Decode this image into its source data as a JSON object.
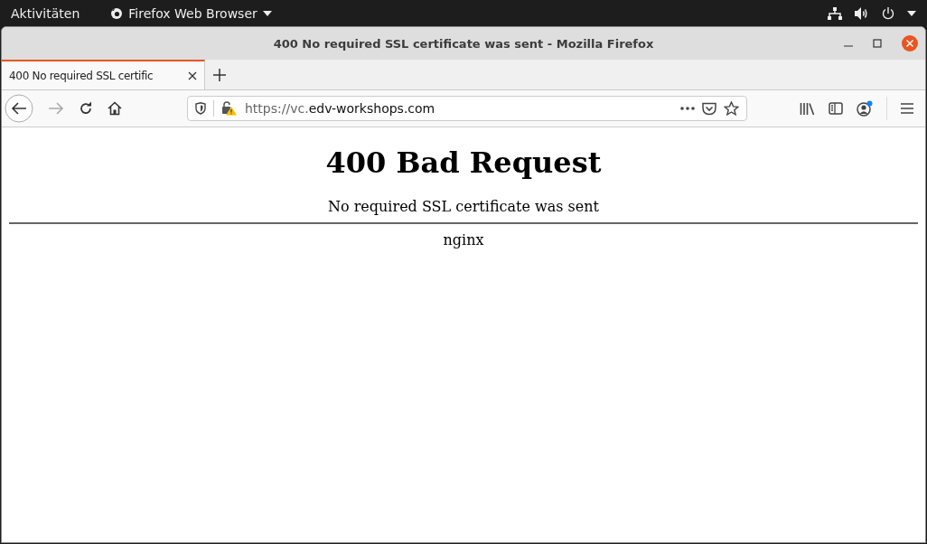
{
  "top_bar": {
    "activities": "Aktivitäten",
    "app_menu": "Firefox Web Browser"
  },
  "window": {
    "title": "400 No required SSL certificate was sent - Mozilla Firefox"
  },
  "tabs": [
    {
      "label": "400 No required SSL certific",
      "selected": true
    }
  ],
  "address_bar": {
    "url_prefix": "https://vc.",
    "url_domain": "edv-workshops.com"
  },
  "toolbar": {
    "forward_disabled": true,
    "account_notification": true
  },
  "page": {
    "heading": "400 Bad Request",
    "message": "No required SSL certificate was sent",
    "server": "nginx"
  }
}
